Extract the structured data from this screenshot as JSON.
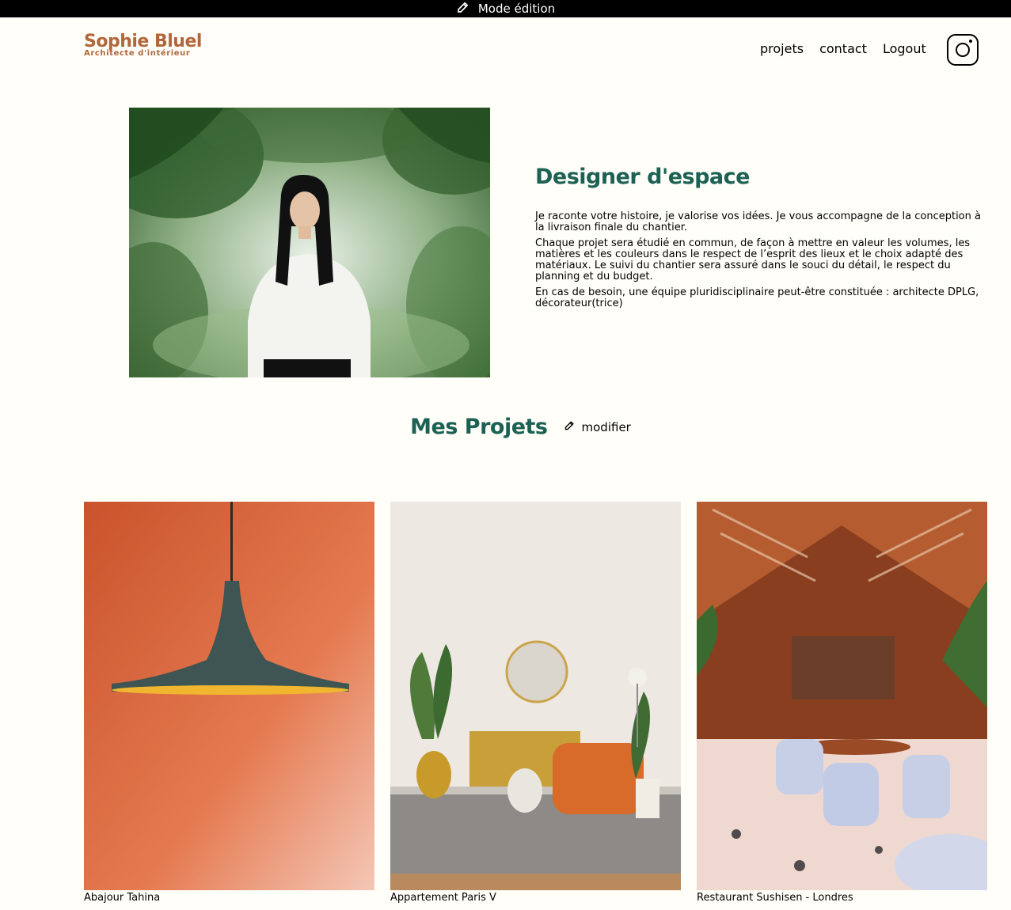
{
  "edit_bar": {
    "label": "Mode édition",
    "icon": "edit-icon"
  },
  "logo": {
    "title": "Sophie Bluel",
    "subtitle": "Architecte d'intérieur",
    "color": "#b1663c"
  },
  "nav": {
    "items": [
      "projets",
      "contact",
      "Logout"
    ],
    "instagram_icon": "instagram-icon"
  },
  "intro": {
    "title": "Designer d'espace",
    "title_color": "#1d6154",
    "paragraphs": [
      "Je raconte votre histoire, je valorise vos idées. Je vous accompagne de la conception à la livraison finale du chantier.",
      "Chaque projet sera étudié en commun, de façon à mettre en valeur les volumes, les matières et les couleurs dans le respect de l’esprit des lieux et le choix adapté des matériaux. Le suivi du chantier sera assuré dans le souci du détail, le respect du planning et du budget.",
      "En cas de besoin, une équipe pluridisciplinaire peut-être constituée : architecte DPLG, décorateur(trice)"
    ]
  },
  "projects": {
    "title": "Mes Projets",
    "modify_label": "modifier",
    "items": [
      {
        "caption": "Abajour Tahina"
      },
      {
        "caption": "Appartement Paris V"
      },
      {
        "caption": "Restaurant Sushisen - Londres"
      }
    ]
  }
}
